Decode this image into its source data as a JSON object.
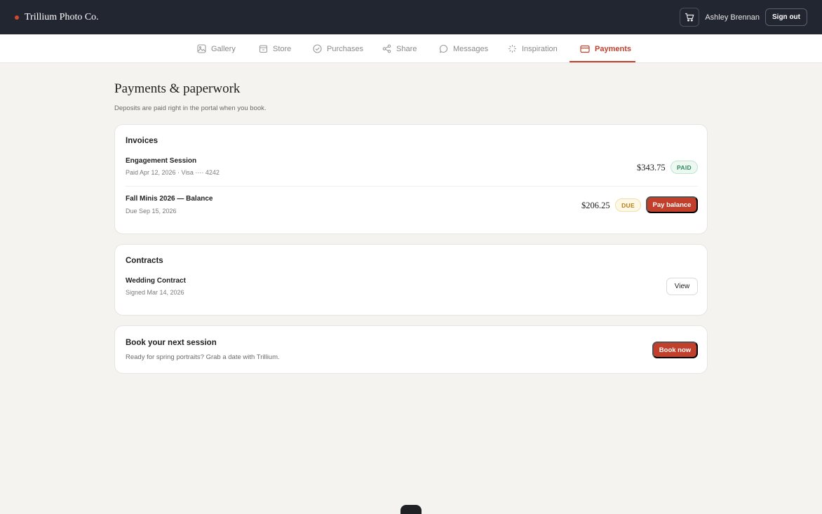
{
  "header": {
    "brand_name": "Trillium Photo Co.",
    "user_name": "Ashley Brennan",
    "sign_out_label": "Sign out"
  },
  "nav": {
    "tabs": [
      {
        "label": "Gallery",
        "icon": "image-icon"
      },
      {
        "label": "Store",
        "icon": "store-icon"
      },
      {
        "label": "Purchases",
        "icon": "check-circle-icon"
      },
      {
        "label": "Share",
        "icon": "share-icon"
      },
      {
        "label": "Messages",
        "icon": "chat-icon"
      },
      {
        "label": "Inspiration",
        "icon": "sparkle-icon"
      },
      {
        "label": "Payments",
        "icon": "credit-card-icon",
        "active": true
      }
    ]
  },
  "page": {
    "title": "Payments & paperwork",
    "subtitle": "Deposits are paid right in the portal when you book."
  },
  "invoices": {
    "title": "Invoices",
    "items": [
      {
        "name": "Engagement Session",
        "meta": "Paid Apr 12, 2026 · Visa ···· 4242",
        "amount": "$343.75",
        "status": "PAID"
      },
      {
        "name": "Fall Minis 2026 — Balance",
        "meta": "Due Sep 15, 2026",
        "amount": "$206.25",
        "status": "DUE",
        "action": "Pay balance"
      }
    ]
  },
  "contracts": {
    "title": "Contracts",
    "items": [
      {
        "name": "Wedding Contract",
        "meta": "Signed Mar 14, 2026",
        "action": "View"
      }
    ]
  },
  "promo": {
    "title": "Book your next session",
    "text": "Ready for spring portraits? Grab a date with Trillium.",
    "action": "Book now"
  },
  "colors": {
    "accent": "#c23f2b",
    "topbar": "#222631",
    "background": "#f4f3f0"
  }
}
